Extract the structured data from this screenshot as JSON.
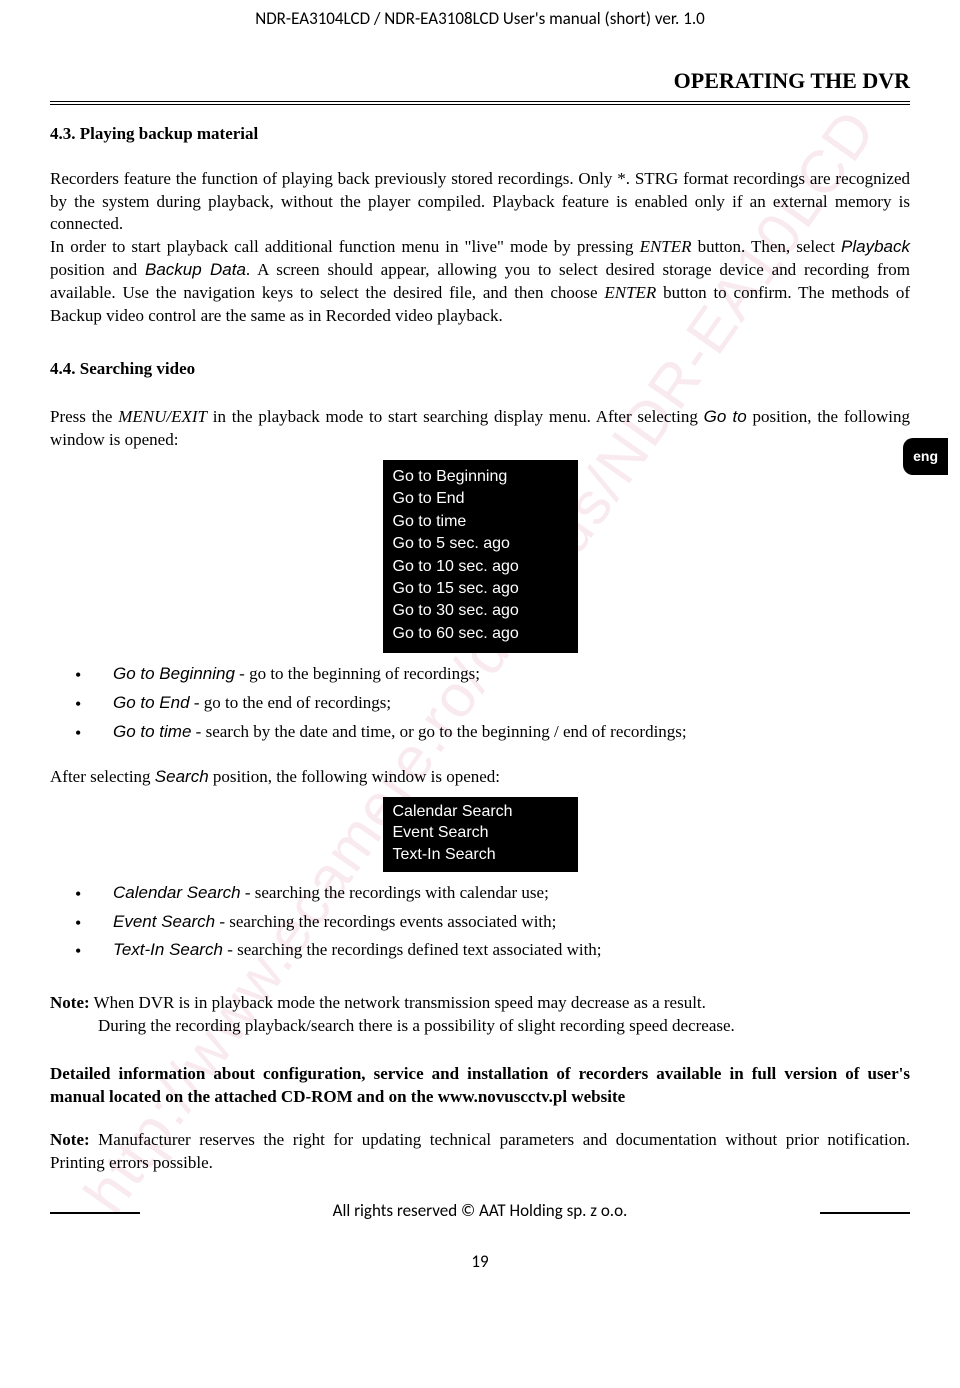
{
  "watermark": "http://www.ecamere.ro/dNovus/NDR-EA10LCD",
  "header": "NDR-EA3104LCD / NDR-EA3108LCD User's manual (short) ver. 1.0",
  "section_title": "OPERATING THE DVR",
  "lang_tab": "eng",
  "sec43": {
    "heading": "4.3. Playing backup material",
    "p1a": "Recorders feature the function of playing back previously stored recordings. Only *. STRG format recordings are recognized by the system during playback, without the player compiled. Playback feature is enabled only if an external memory is connected.",
    "p1b_a": "In order to start playback call additional function menu in \"live\" mode  by pressing ",
    "p1b_enter": "ENTER",
    "p1b_b": " button. Then, select ",
    "p1b_playback": "Playback",
    "p1b_c": " position and ",
    "p1b_backup": "Backup Data",
    "p1b_d": ". A screen should appear, allowing you to select desired storage device and recording from available. Use the navigation keys to select the desired file, and then choose ",
    "p1b_enter2": "ENTER",
    "p1b_e": " button to confirm. The methods of Backup video control are the same as in Recorded video playback."
  },
  "sec44": {
    "heading": "4.4.   Searching video",
    "intro_a": "Press the ",
    "intro_menuexit": "MENU/EXIT",
    "intro_b": " in the playback mode to start searching display menu. After selecting ",
    "intro_goto": "Go to",
    "intro_c": " position, the following window is opened:",
    "menu1": [
      "Go to Beginning",
      "Go to End",
      "Go to time",
      "Go to 5 sec. ago",
      "Go to 10 sec. ago",
      "Go to 15 sec. ago",
      "Go to 30 sec. ago",
      "Go to 60 sec. ago"
    ],
    "bullets1": [
      {
        "term": "Go to Beginning",
        "desc": " - go to the beginning of recordings;"
      },
      {
        "term": "Go to End",
        "desc": " - go to the end of recordings;"
      },
      {
        "term": "Go to time",
        "desc": " - search by the date and time, or go to the beginning / end of recordings;"
      }
    ],
    "intro2_a": "After selecting ",
    "intro2_search": "Search",
    "intro2_b": " position, the following window is opened:",
    "menu2": [
      "Calendar Search",
      "Event Search",
      "Text-In Search"
    ],
    "bullets2": [
      {
        "term": "Calendar Search",
        "desc": " - searching the recordings with calendar use;"
      },
      {
        "term": "Event Search",
        "desc": " - searching the recordings events associated with;"
      },
      {
        "term": "Text-In Search",
        "desc": " - searching the recordings defined text associated with;"
      }
    ]
  },
  "note1_label": "Note:",
  "note1_a": " When DVR is in playback mode the network transmission speed may decrease as a result.",
  "note1_b": "During the recording playback/search there is a possibility of slight recording speed decrease.",
  "detailed": "Detailed information about configuration, service and installation of recorders available in full version of user's manual located on the attached CD-ROM and on the www.novuscctv.pl website",
  "note2_label": "Note:",
  "note2": " Manufacturer reserves the right for updating technical parameters and documentation without prior notification. Printing errors possible.",
  "footer": "All rights reserved © AAT Holding sp. z o.o.",
  "page_num": "19"
}
